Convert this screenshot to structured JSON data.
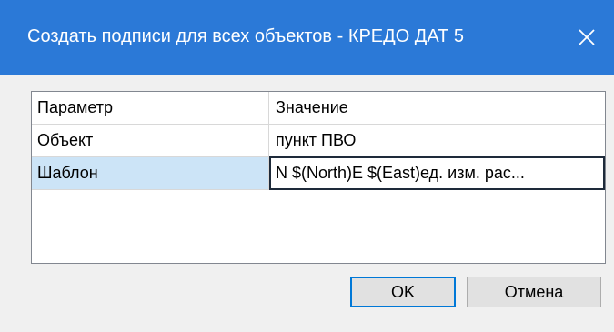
{
  "window": {
    "title": "Создать подписи для всех объектов - КРЕДО ДАТ 5",
    "close_icon": "close-icon",
    "titlebar_color": "#2b79d7"
  },
  "grid": {
    "headers": {
      "param": "Параметр",
      "value": "Значение"
    },
    "rows": [
      {
        "param": "Объект",
        "value": "пункт ПВО"
      },
      {
        "param": "Шаблон",
        "value": "N $(North)E $(East)ед. изм. рас..."
      }
    ],
    "selected_row_color": "#cce4f7"
  },
  "buttons": {
    "ok_label": "OK",
    "cancel_label": "Отмена"
  }
}
